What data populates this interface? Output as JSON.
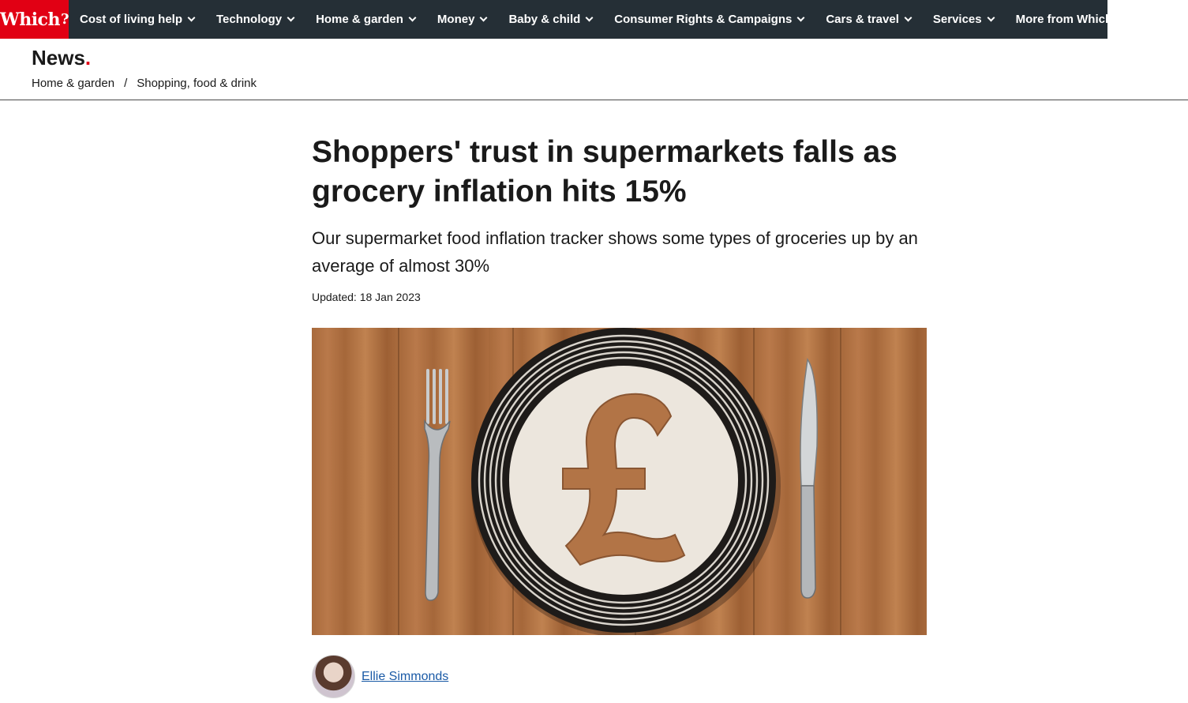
{
  "brand": {
    "logo_text": "Which",
    "logo_mark": "?",
    "accent": "#e10014",
    "nav_bg": "#252f36"
  },
  "nav": {
    "items": [
      {
        "label": "Cost of living help"
      },
      {
        "label": "Technology"
      },
      {
        "label": "Home & garden"
      },
      {
        "label": "Money"
      },
      {
        "label": "Baby & child"
      },
      {
        "label": "Consumer Rights & Campaigns"
      },
      {
        "label": "Cars & travel"
      },
      {
        "label": "Services"
      },
      {
        "label": "More from Which?"
      }
    ]
  },
  "section": {
    "title": "News",
    "title_dot": "."
  },
  "breadcrumb": {
    "items": [
      "Home & garden",
      "Shopping, food & drink"
    ],
    "separator": "/"
  },
  "article": {
    "headline": "Shoppers' trust in supermarkets falls as grocery inflation hits 15%",
    "standfirst": "Our supermarket food inflation tracker shows some types of groceries up by an average of almost 30%",
    "updated": "Updated: 18 Jan 2023",
    "hero_image": "plate-with-pound-sign-cutout-fork-and-knife"
  },
  "author": {
    "name": "Ellie Simmonds"
  }
}
